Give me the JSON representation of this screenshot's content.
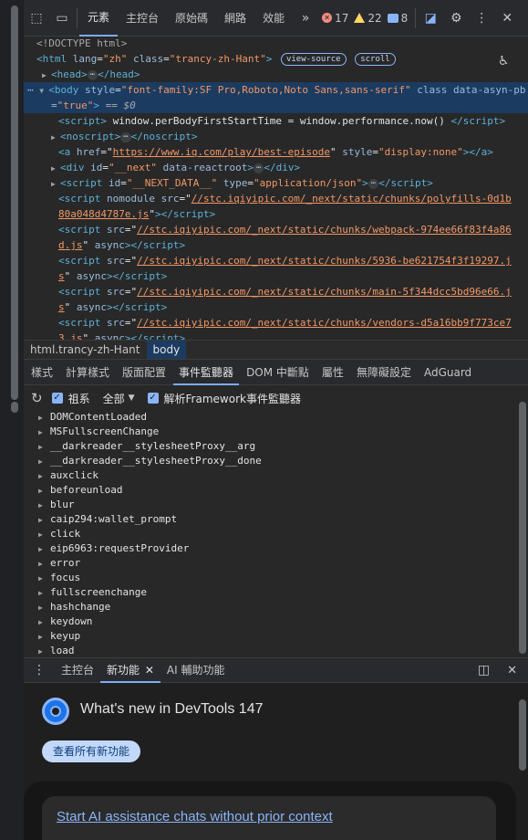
{
  "toolbar": {
    "tabs": [
      "元素",
      "主控台",
      "原始碼",
      "網路",
      "效能"
    ],
    "more": "»",
    "errors": "17",
    "warnings": "22",
    "messages": "8"
  },
  "tree": {
    "doctype": "<!DOCTYPE html>",
    "html_open": "html",
    "html_lang_attr": "lang",
    "html_lang_val": "\"zh\"",
    "html_class_attr": "class",
    "html_class_val": "\"trancy-zh-Hant\"",
    "view_source": "view-source",
    "scroll": "scroll",
    "head": "head",
    "body_style_attr": "style",
    "body_style_val": "\"font-family:SF Pro,Roboto,Noto Sans,sans-serif\"",
    "body_class_attr": "class",
    "body_data_attr": "data-asyn-pb",
    "body_data_val": "\"true\"",
    "body_eq": "== $0",
    "script1_text": "window.perBodyFirstStartTime = window.performance.now()",
    "noscript": "noscript",
    "a_href_val": "https://www.iq.com/play/best-episode",
    "a_style_val": "\"display:none\"",
    "div_id_val": "\"__next\"",
    "div_data_attr": "data-reactroot",
    "script2_id_val": "\"__NEXT_DATA__\"",
    "script2_type_val": "\"application/json\"",
    "nomodule_src_a": "//stc.iqiyipic.com/_next/static/chunks/polyfills-0d1b",
    "nomodule_src_b": "80a048d4787e.js",
    "webpack_src_a": "//stc.iqiyipic.com/_next/static/chunks/webpack-974ee66f83f4a86",
    "webpack_src_b": "d.js",
    "s5936_src_a": "//stc.iqiyipic.com/_next/static/chunks/5936-be621754f3f19297.j",
    "s5936_src_b": "s",
    "main_src_a": "//stc.iqiyipic.com/_next/static/chunks/main-5f344dcc5bd96e66.j",
    "main_src_b": "s",
    "vendors_src_a": "//stc.iqiyipic.com/_next/static/chunks/vendors-d5a16bb9f773ce7",
    "vendors_src_b": "3.js",
    "async": "async"
  },
  "breadcrumb": [
    "html.trancy-zh-Hant",
    "body"
  ],
  "subtabs": [
    "樣式",
    "計算樣式",
    "版面配置",
    "事件監聽器",
    "DOM 中斷點",
    "屬性",
    "無障礙設定",
    "AdGuard"
  ],
  "controls": {
    "ancestors": "祖系",
    "filter": "全部",
    "framework": "解析Framework事件監聽器"
  },
  "events": [
    "DOMContentLoaded",
    "MSFullscreenChange",
    "__darkreader__stylesheetProxy__arg",
    "__darkreader__stylesheetProxy__done",
    "auxclick",
    "beforeunload",
    "blur",
    "caip294:wallet_prompt",
    "click",
    "eip6963:requestProvider",
    "error",
    "focus",
    "fullscreenchange",
    "hashchange",
    "keydown",
    "keyup",
    "load"
  ],
  "drawer": {
    "tabs": [
      "主控台",
      "新功能",
      "AI 輔助功能"
    ],
    "title": "What's new in DevTools 147",
    "see_all": "查看所有新功能",
    "card_link": "Start AI assistance chats without prior context"
  }
}
